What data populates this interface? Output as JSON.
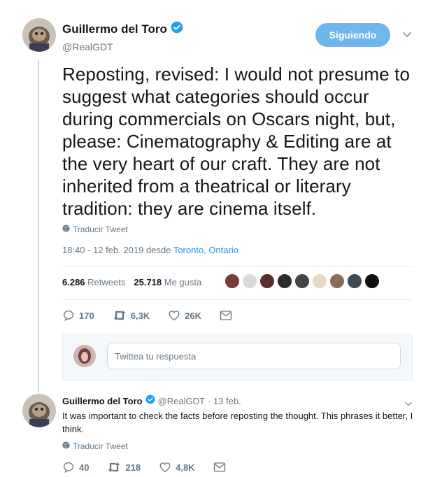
{
  "tweet": {
    "author_name": "Guillermo del Toro",
    "author_handle": "@RealGDT",
    "follow_label": "Siguiendo",
    "text": "Reposting, revised: I would not presume to suggest what categories should occur during commercials on Oscars night, but, please: Cinematography & Editing are at the very heart of our craft. They are not inherited from a theatrical or literary tradition: they are cinema itself.",
    "translate_label": "Traducir Tweet",
    "time": "18:40 - 12 feb. 2019",
    "from_label": "desde",
    "location": "Toronto, Ontario",
    "retweets_count": "6.286",
    "retweets_label": "Retweets",
    "likes_count": "25.718",
    "likes_label": "Me gusta",
    "actions": {
      "replies": "170",
      "retweets": "6,3K",
      "likes": "26K"
    }
  },
  "reply_composer": {
    "placeholder": "Twittea tu respuesta"
  },
  "reply": {
    "author_name": "Guillermo del Toro",
    "author_handle": "@RealGDT",
    "date": "· 13 feb.",
    "text": "It was important to check the facts before reposting the thought. This phrases it better, I think.",
    "translate_label": "Traducir Tweet",
    "actions": {
      "replies": "40",
      "retweets": "218",
      "likes": "4,8K"
    }
  },
  "colors": {
    "accent": "#1da1f2",
    "follow_button": "#6fb6eb",
    "muted": "#657786",
    "link": "#1b95e0"
  }
}
